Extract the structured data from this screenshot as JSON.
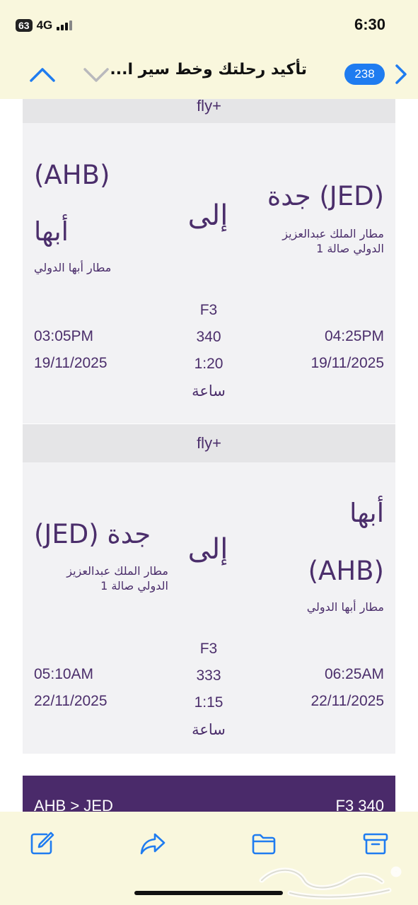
{
  "status": {
    "battery": "63",
    "network": "4G",
    "time": "6:30"
  },
  "nav": {
    "title": "تأكيد رحلتك وخط سير ا...",
    "badge": "238"
  },
  "flights": [
    {
      "airline": "fly+",
      "depart_code_city": "(JED) جدة",
      "depart_airport": "مطار الملك عبدالعزيز الدولي صالة 1",
      "to_label": "إلى",
      "arrive_code": "(AHB)",
      "arrive_city": "أبها",
      "arrive_airport": "مطار أبها الدولي",
      "carrier": "F3",
      "flight_no": "340",
      "duration": "1:20",
      "duration_unit": "ساعة",
      "depart_time": "04:25PM",
      "depart_date": "19/11/2025",
      "arrive_time": "03:05PM",
      "arrive_date": "19/11/2025"
    },
    {
      "airline": "fly+",
      "depart_city": "أبها",
      "depart_code": "(AHB)",
      "depart_airport": "مطار أبها الدولي",
      "to_label": "إلى",
      "arrive_code_city": "(JED) جدة",
      "arrive_airport": "مطار الملك عبدالعزيز الدولي صالة 1",
      "carrier": "F3",
      "flight_no": "333",
      "duration": "1:15",
      "duration_unit": "ساعة",
      "depart_time": "06:25AM",
      "depart_date": "22/11/2025",
      "arrive_time": "05:10AM",
      "arrive_date": "22/11/2025"
    }
  ],
  "summary": {
    "route": "AHB > JED",
    "flight": "F3 340"
  },
  "toolbar": {
    "icons": [
      "compose-icon",
      "forward-icon",
      "folder-icon",
      "archive-icon"
    ]
  },
  "watermark": {
    "text": "حراج"
  },
  "colors": {
    "accent": "#4b2e6b",
    "link": "#1f7cf0",
    "chrome": "#f9f7dd"
  }
}
